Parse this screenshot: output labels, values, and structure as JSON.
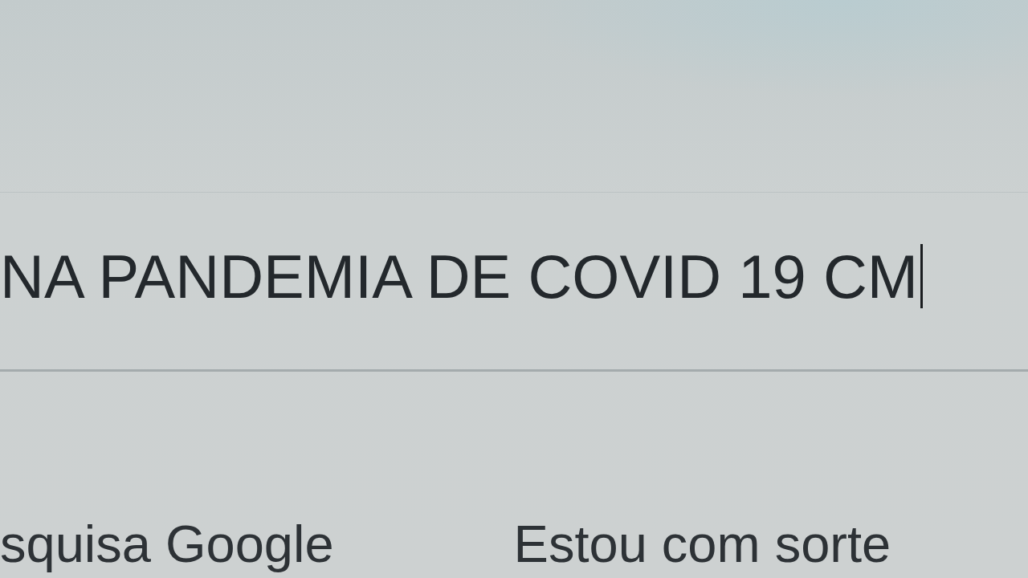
{
  "search": {
    "value": "NA PANDEMIA DE COVID 19 CM",
    "focused": true
  },
  "buttons": [
    {
      "label": "squisa Google"
    },
    {
      "label": "Estou com sorte"
    }
  ]
}
